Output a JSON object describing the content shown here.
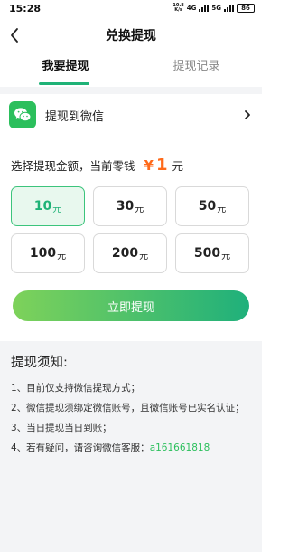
{
  "status_bar": {
    "time": "15:28",
    "speed_top": "10.8",
    "speed_bottom": "K/s",
    "net1": "4G",
    "net2": "5G",
    "battery": "86"
  },
  "nav": {
    "title": "兑换提现"
  },
  "tabs": [
    {
      "label": "我要提现",
      "active": true
    },
    {
      "label": "提现记录",
      "active": false
    }
  ],
  "withdraw_method": {
    "label": "提现到微信",
    "icon": "wechat-icon"
  },
  "amount": {
    "prompt": "选择提现金额，当前零钱",
    "currency_symbol": "¥",
    "balance": "1",
    "unit": "元"
  },
  "options": [
    {
      "value": "10",
      "unit": "元",
      "selected": true
    },
    {
      "value": "30",
      "unit": "元",
      "selected": false
    },
    {
      "value": "50",
      "unit": "元",
      "selected": false
    },
    {
      "value": "100",
      "unit": "元",
      "selected": false
    },
    {
      "value": "200",
      "unit": "元",
      "selected": false
    },
    {
      "value": "500",
      "unit": "元",
      "selected": false
    }
  ],
  "submit_label": "立即提现",
  "notes": {
    "title": "提现须知:",
    "items": [
      "1、目前仅支持微信提现方式；",
      "2、微信提现须绑定微信账号，且微信账号已实名认证；",
      "3、当日提现当日到账；",
      "4、若有疑问，请咨询微信客服："
    ],
    "contact": "a161661818"
  },
  "colors": {
    "accent": "#1fb277",
    "balance": "#ff6a1a",
    "wechat": "#2bbf5c",
    "gradient_start": "#7ed25a",
    "gradient_end": "#1fb07b"
  }
}
